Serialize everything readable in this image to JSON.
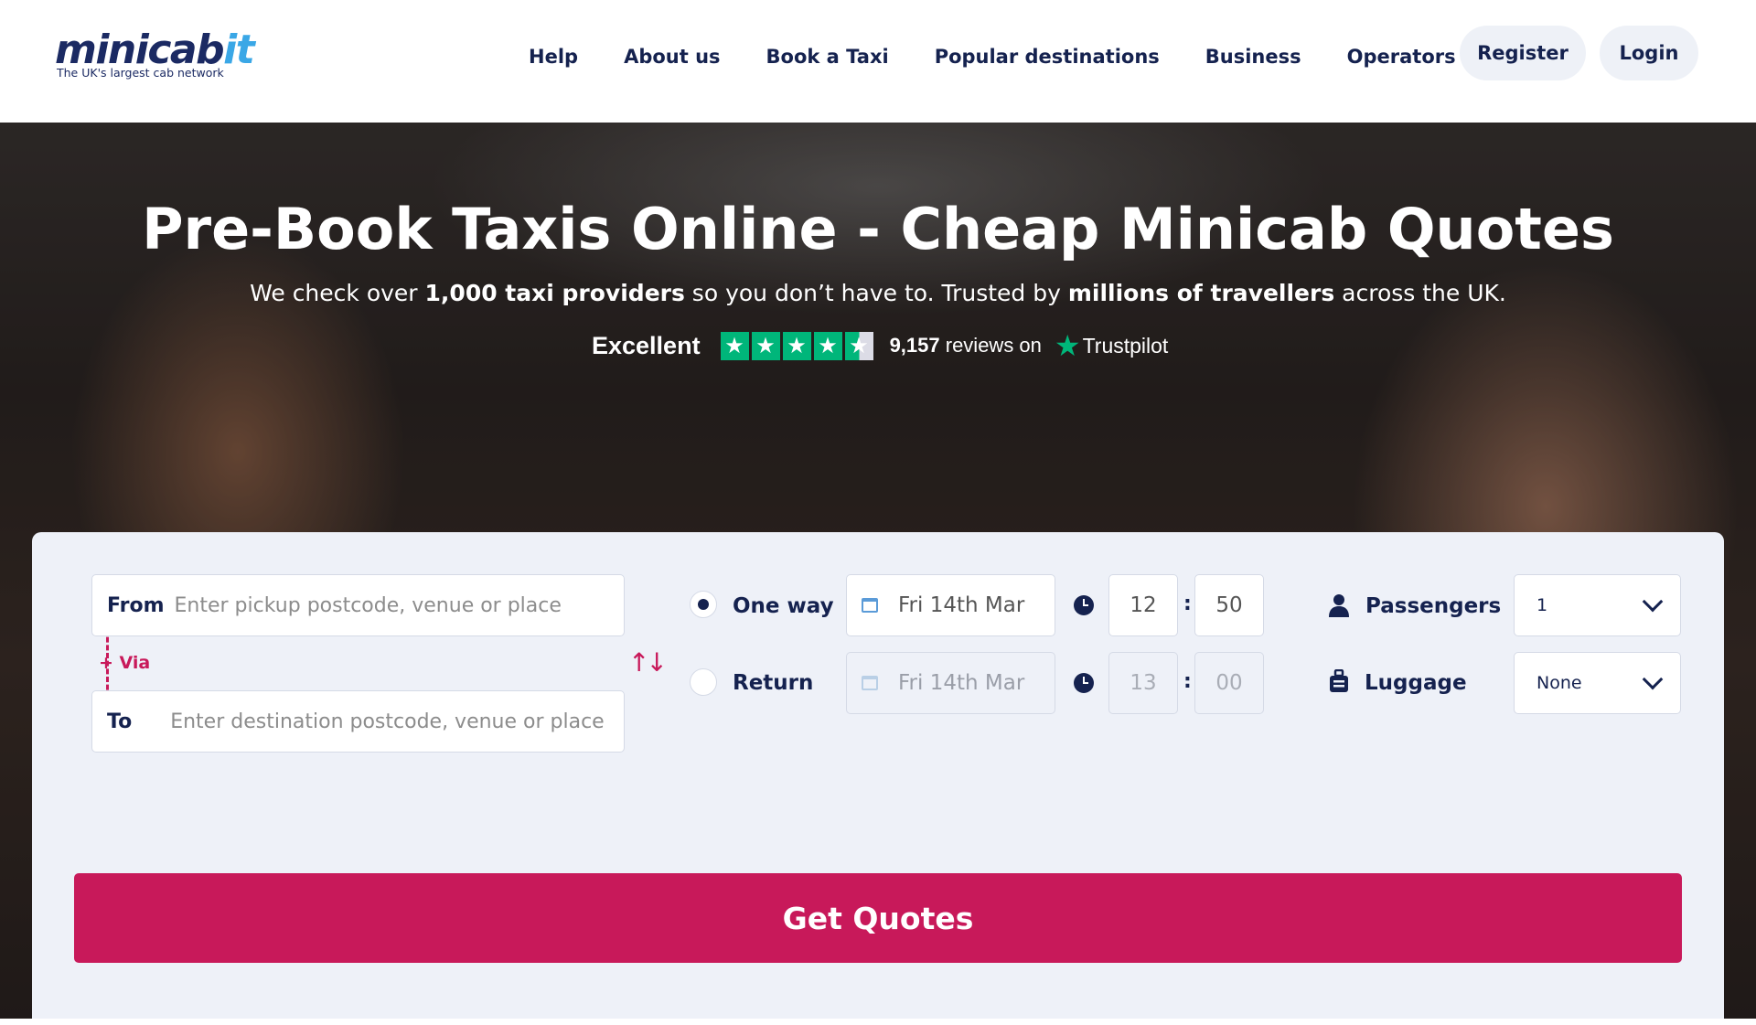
{
  "header": {
    "logo": {
      "text_main": "minicab",
      "text_accent": "it",
      "tagline": "The UK's largest cab network"
    },
    "nav": [
      "Help",
      "About us",
      "Book a Taxi",
      "Popular destinations",
      "Business",
      "Operators"
    ],
    "register_label": "Register",
    "login_label": "Login"
  },
  "hero": {
    "title": "Pre-Book Taxis Online - Cheap Minicab Quotes",
    "subtitle": {
      "part1": "We check over ",
      "bold1": "1,000 taxi providers",
      "part2": " so you don’t have to. Trusted by ",
      "bold2": "millions of travellers",
      "part3": " across the UK."
    },
    "trustpilot": {
      "rating_word": "Excellent",
      "stars": 4.5,
      "review_count": "9,157",
      "reviews_suffix": "reviews on",
      "brand": "Trustpilot"
    }
  },
  "booking": {
    "from": {
      "label": "From",
      "placeholder": "Enter pickup postcode, venue or place",
      "value": ""
    },
    "to": {
      "label": "To",
      "placeholder": "Enter destination postcode, venue or place",
      "value": ""
    },
    "via_label": "+ Via",
    "swap_icon": "swap-icon",
    "one_way": {
      "label": "One way",
      "selected": true,
      "date": "Fri 14th Mar",
      "hour": "12",
      "minute": "50"
    },
    "return": {
      "label": "Return",
      "selected": false,
      "date": "Fri 14th Mar",
      "hour": "13",
      "minute": "00"
    },
    "passengers": {
      "label": "Passengers",
      "value": "1"
    },
    "luggage": {
      "label": "Luggage",
      "value": "None"
    },
    "cta_label": "Get Quotes"
  },
  "colors": {
    "brand_navy": "#15224f",
    "accent_pink": "#c8195a",
    "trustpilot_green": "#00b67a",
    "card_bg": "#eef1f8"
  }
}
